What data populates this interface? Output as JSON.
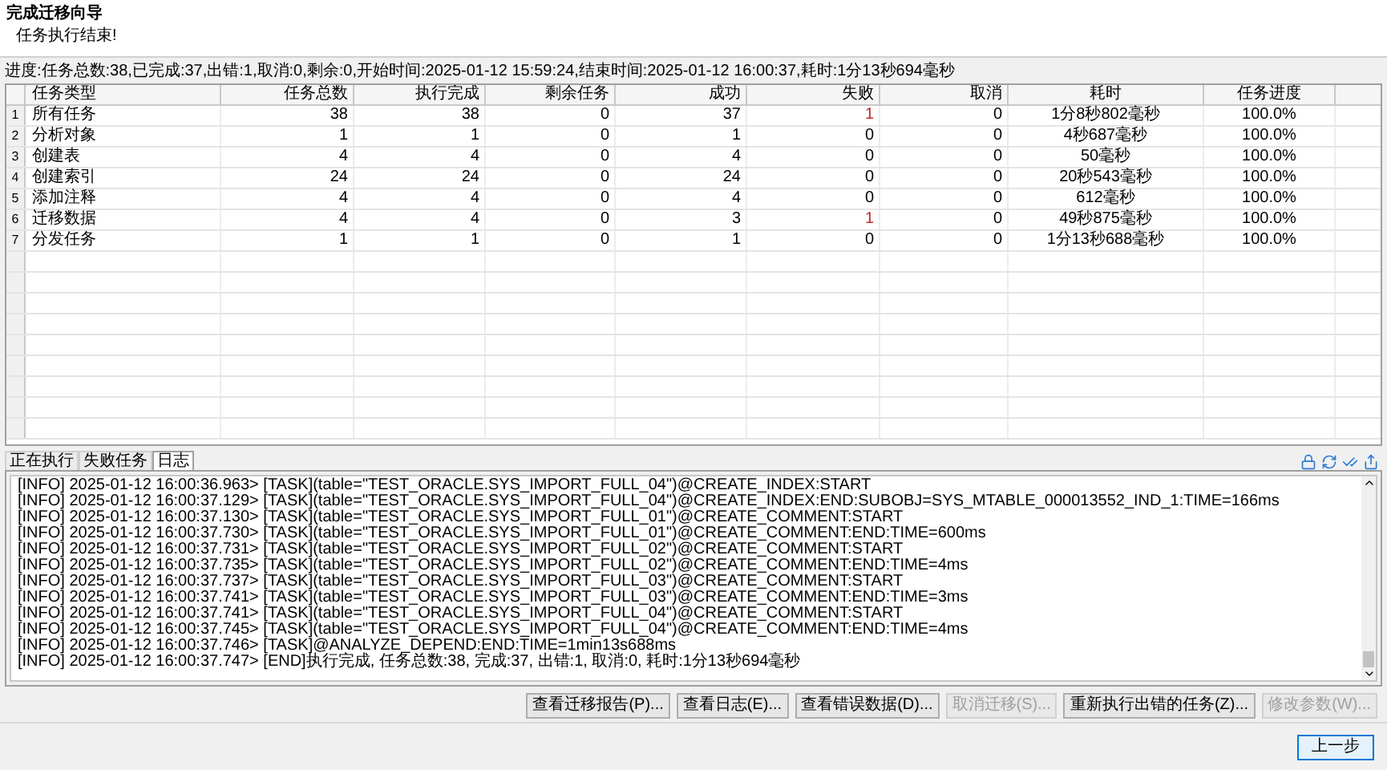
{
  "header": {
    "title": "完成迁移向导",
    "subtitle": "任务执行结束!"
  },
  "progress": "进度:任务总数:38,已完成:37,出错:1,取消:0,剩余:0,开始时间:2025-01-12 15:59:24,结束时间:2025-01-12 16:00:37,耗时:1分13秒694毫秒",
  "table": {
    "columns": [
      "任务类型",
      "任务总数",
      "执行完成",
      "剩余任务",
      "成功",
      "失败",
      "取消",
      "耗时",
      "任务进度"
    ],
    "rows": [
      {
        "index": "1",
        "failed_alert": true,
        "cells": [
          "所有任务",
          "38",
          "38",
          "0",
          "37",
          "1",
          "0",
          "1分8秒802毫秒",
          "100.0%"
        ]
      },
      {
        "index": "2",
        "failed_alert": false,
        "cells": [
          "分析对象",
          "1",
          "1",
          "0",
          "1",
          "0",
          "0",
          "4秒687毫秒",
          "100.0%"
        ]
      },
      {
        "index": "3",
        "failed_alert": false,
        "cells": [
          "创建表",
          "4",
          "4",
          "0",
          "4",
          "0",
          "0",
          "50毫秒",
          "100.0%"
        ]
      },
      {
        "index": "4",
        "failed_alert": false,
        "cells": [
          "创建索引",
          "24",
          "24",
          "0",
          "24",
          "0",
          "0",
          "20秒543毫秒",
          "100.0%"
        ]
      },
      {
        "index": "5",
        "failed_alert": false,
        "cells": [
          "添加注释",
          "4",
          "4",
          "0",
          "4",
          "0",
          "0",
          "612毫秒",
          "100.0%"
        ]
      },
      {
        "index": "6",
        "failed_alert": true,
        "cells": [
          "迁移数据",
          "4",
          "4",
          "0",
          "3",
          "1",
          "0",
          "49秒875毫秒",
          "100.0%"
        ]
      },
      {
        "index": "7",
        "failed_alert": false,
        "cells": [
          "分发任务",
          "1",
          "1",
          "0",
          "1",
          "0",
          "0",
          "1分13秒688毫秒",
          "100.0%"
        ]
      }
    ]
  },
  "tabs": [
    {
      "label": "正在执行",
      "selected": false
    },
    {
      "label": "失败任务",
      "selected": false
    },
    {
      "label": "日志",
      "selected": true
    }
  ],
  "log": [
    "[INFO] 2025-01-12 16:00:36.963> [TASK](table=\"TEST_ORACLE.SYS_IMPORT_FULL_04\")@CREATE_INDEX:START",
    "[INFO] 2025-01-12 16:00:37.129> [TASK](table=\"TEST_ORACLE.SYS_IMPORT_FULL_04\")@CREATE_INDEX:END:SUBOBJ=SYS_MTABLE_000013552_IND_1:TIME=166ms",
    "[INFO] 2025-01-12 16:00:37.130> [TASK](table=\"TEST_ORACLE.SYS_IMPORT_FULL_01\")@CREATE_COMMENT:START",
    "[INFO] 2025-01-12 16:00:37.730> [TASK](table=\"TEST_ORACLE.SYS_IMPORT_FULL_01\")@CREATE_COMMENT:END:TIME=600ms",
    "[INFO] 2025-01-12 16:00:37.731> [TASK](table=\"TEST_ORACLE.SYS_IMPORT_FULL_02\")@CREATE_COMMENT:START",
    "[INFO] 2025-01-12 16:00:37.735> [TASK](table=\"TEST_ORACLE.SYS_IMPORT_FULL_02\")@CREATE_COMMENT:END:TIME=4ms",
    "[INFO] 2025-01-12 16:00:37.737> [TASK](table=\"TEST_ORACLE.SYS_IMPORT_FULL_03\")@CREATE_COMMENT:START",
    "[INFO] 2025-01-12 16:00:37.741> [TASK](table=\"TEST_ORACLE.SYS_IMPORT_FULL_03\")@CREATE_COMMENT:END:TIME=3ms",
    "[INFO] 2025-01-12 16:00:37.741> [TASK](table=\"TEST_ORACLE.SYS_IMPORT_FULL_04\")@CREATE_COMMENT:START",
    "[INFO] 2025-01-12 16:00:37.745> [TASK](table=\"TEST_ORACLE.SYS_IMPORT_FULL_04\")@CREATE_COMMENT:END:TIME=4ms",
    "[INFO] 2025-01-12 16:00:37.746> [TASK]@ANALYZE_DEPEND:END:TIME=1min13s688ms",
    "[INFO] 2025-01-12 16:00:37.747> [END]执行完成, 任务总数:38, 完成:37, 出错:1, 取消:0, 耗时:1分13秒694毫秒"
  ],
  "actions": [
    {
      "label": "查看迁移报告(P)...",
      "disabled": false
    },
    {
      "label": "查看日志(E)...",
      "disabled": false
    },
    {
      "label": "查看错误数据(D)...",
      "disabled": false
    },
    {
      "label": "取消迁移(S)...",
      "disabled": true
    },
    {
      "label": "重新执行出错的任务(Z)...",
      "disabled": false
    },
    {
      "label": "修改参数(W)...",
      "disabled": true
    }
  ],
  "footer_button": "上一步"
}
